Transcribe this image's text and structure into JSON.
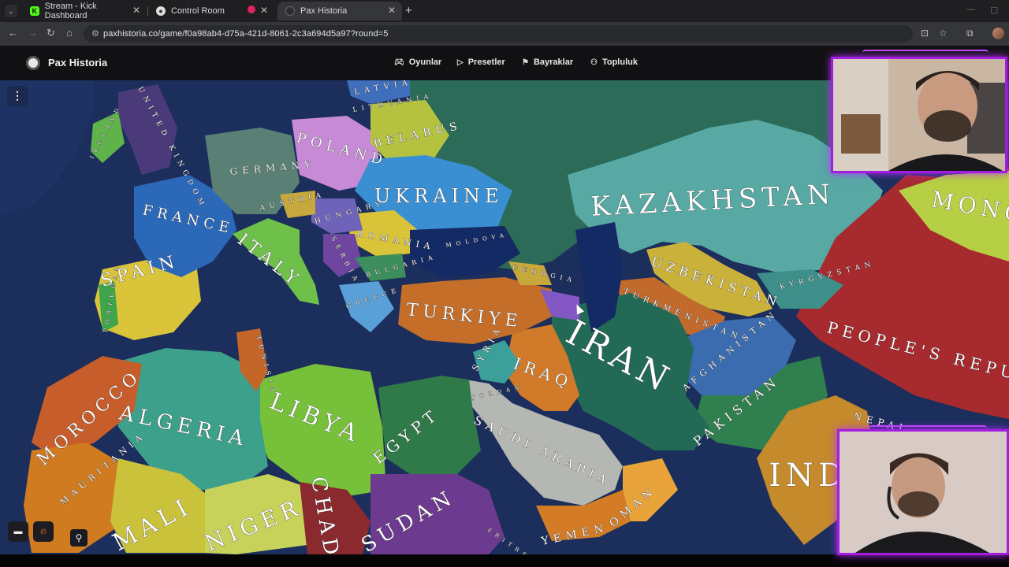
{
  "browser": {
    "tabs": [
      {
        "title": "Stream - Kick Dashboard",
        "icon": "kick-icon",
        "active": false
      },
      {
        "title": "Control Room",
        "icon": "globe-icon",
        "active": false
      },
      {
        "title": "Pax Historia",
        "icon": "pax-historia-icon",
        "active": true
      }
    ],
    "new_tab_label": "+",
    "url": "paxhistoria.co/game/f0a98ab4-d75a-421d-8061-2c3a694d5a97?round=5"
  },
  "app": {
    "brand": "Pax Historia",
    "nav": [
      {
        "label": "Oyunlar",
        "icon": "gamepad-icon"
      },
      {
        "label": "Presetler",
        "icon": "play-icon"
      },
      {
        "label": "Bayraklar",
        "icon": "flag-icon"
      },
      {
        "label": "Topluluk",
        "icon": "people-icon"
      }
    ]
  },
  "map": {
    "labels": [
      "KAZAKHSTAN",
      "UKRAINE",
      "POLAND",
      "BELARUS",
      "GERMANY",
      "FRANCE",
      "ITALY",
      "SPAIN",
      "HUNGARY",
      "ROMANIA",
      "BULGARIA",
      "GREECE",
      "TURKIYE",
      "IRAN",
      "IRAQ",
      "SYRIA",
      "SAUDI ARABIA",
      "YEMEN",
      "OMAN",
      "EGYPT",
      "LIBYA",
      "ALGERIA",
      "MOROCCO",
      "MAURITANIA",
      "MALI",
      "NIGER",
      "SUDAN",
      "CHAD",
      "UZBEKISTAN",
      "TURKMENISTAN",
      "KYRGYZSTAN",
      "AFGHANISTAN",
      "PAKISTAN",
      "PEOPLE'S REPUBLIC",
      "MONGOLIA",
      "INDIA",
      "NEPAL",
      "UNITED KINGDOM",
      "IRELAND",
      "LATVIA",
      "LITHUANIA",
      "AUSTRIA",
      "SERBIA",
      "GEORGIA",
      "TUNISIA",
      "PORTUGAL",
      "JORDAN",
      "ERITREA",
      "MOLDOVA"
    ]
  },
  "colors": {
    "ocean": "#1b2e5c",
    "webcam_border": "#a31de0",
    "app_header": "#111113"
  }
}
